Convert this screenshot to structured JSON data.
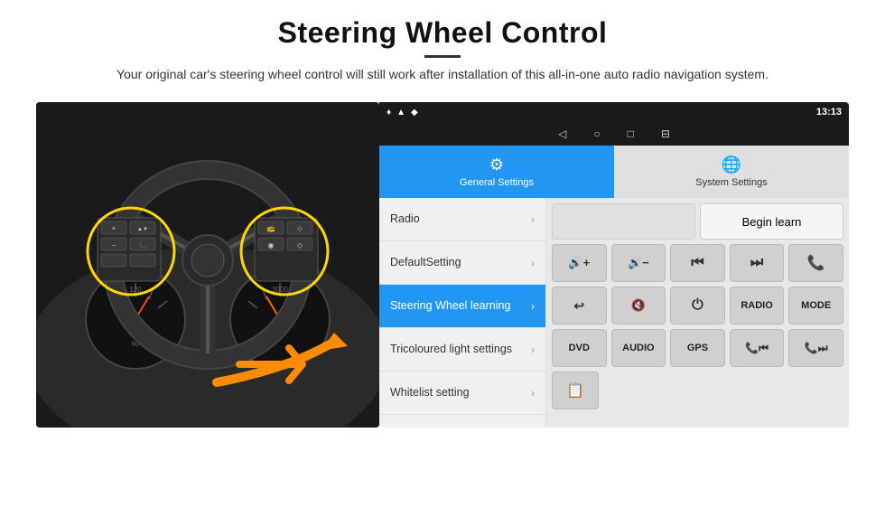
{
  "header": {
    "title": "Steering Wheel Control",
    "subtitle": "Your original car's steering wheel control will still work after installation of this all-in-one auto radio navigation system."
  },
  "status_bar": {
    "time": "13:13",
    "location_icon": "♦",
    "wifi_icon": "▲",
    "signal_icon": "◆"
  },
  "nav_bar": {
    "back_icon": "◁",
    "home_icon": "○",
    "square_icon": "□",
    "menu_icon": "⊟"
  },
  "tabs": [
    {
      "id": "general",
      "label": "General Settings",
      "icon": "⚙",
      "active": true
    },
    {
      "id": "system",
      "label": "System Settings",
      "icon": "🌐",
      "active": false
    }
  ],
  "menu_items": [
    {
      "id": "radio",
      "label": "Radio",
      "active": false
    },
    {
      "id": "default",
      "label": "DefaultSetting",
      "active": false
    },
    {
      "id": "steering",
      "label": "Steering Wheel learning",
      "active": true
    },
    {
      "id": "tricoloured",
      "label": "Tricoloured light settings",
      "active": false
    },
    {
      "id": "whitelist",
      "label": "Whitelist setting",
      "active": false
    }
  ],
  "control_panel": {
    "begin_learn_label": "Begin learn",
    "rows": [
      [
        {
          "symbol": "🔊+",
          "type": "symbol"
        },
        {
          "symbol": "🔊–",
          "type": "symbol"
        },
        {
          "symbol": "⏮",
          "type": "symbol"
        },
        {
          "symbol": "⏭",
          "type": "symbol"
        },
        {
          "symbol": "📞",
          "type": "symbol"
        }
      ],
      [
        {
          "symbol": "📞↩",
          "type": "symbol"
        },
        {
          "symbol": "🔇",
          "type": "symbol"
        },
        {
          "symbol": "⏻",
          "type": "symbol"
        },
        {
          "text": "RADIO",
          "type": "text"
        },
        {
          "text": "MODE",
          "type": "text"
        }
      ],
      [
        {
          "text": "DVD",
          "type": "text"
        },
        {
          "text": "AUDIO",
          "type": "text"
        },
        {
          "text": "GPS",
          "type": "text"
        },
        {
          "symbol": "📞⏮",
          "type": "symbol"
        },
        {
          "symbol": "📞⏭",
          "type": "symbol"
        }
      ]
    ],
    "last_row": [
      {
        "symbol": "📋",
        "type": "symbol"
      }
    ]
  }
}
